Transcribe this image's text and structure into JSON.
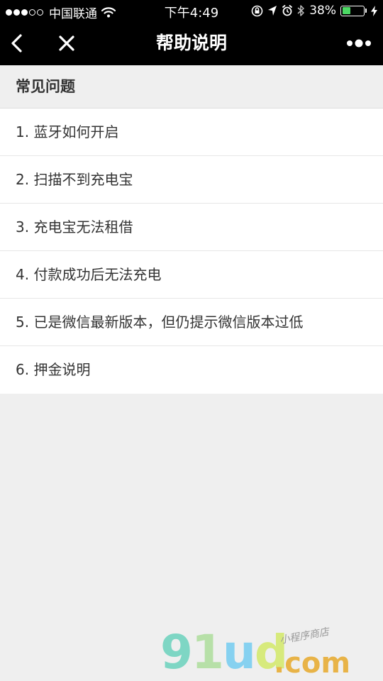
{
  "status_bar": {
    "carrier": "中国联通",
    "time": "下午4:49",
    "battery_percent_label": "38%",
    "battery_level": 0.38,
    "battery_color": "#4cd964"
  },
  "nav": {
    "title": "帮助说明",
    "back_icon": "chevron-left-icon",
    "close_icon": "close-icon",
    "more_icon": "more-dots-icon"
  },
  "section": {
    "title": "常见问题"
  },
  "faq_items": [
    {
      "label": "1. 蓝牙如何开启"
    },
    {
      "label": "2. 扫描不到充电宝"
    },
    {
      "label": "3. 充电宝无法租借"
    },
    {
      "label": "4. 付款成功后无法充电"
    },
    {
      "label": "5. 已是微信最新版本，但仍提示微信版本过低"
    },
    {
      "label": "6. 押金说明"
    }
  ],
  "watermark": {
    "brand_g": "9",
    "brand_1": "1",
    "brand_u": "u",
    "brand_d": "d",
    "domain": ".com",
    "tag": "小程序商店"
  }
}
